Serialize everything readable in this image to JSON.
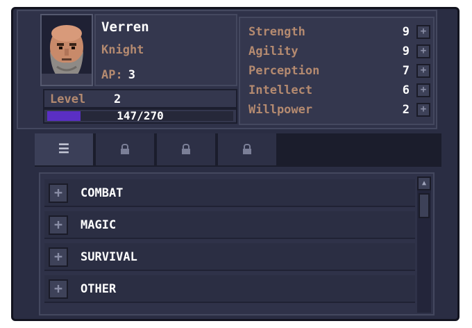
{
  "character": {
    "name": "Verren",
    "class": "Knight",
    "ap_label": "AP:",
    "ap_value": "3",
    "level_label": "Level",
    "level_value": "2",
    "xp_text": "147/270",
    "xp_fraction": 0.18,
    "portrait_icon": "bearded-knight-portrait"
  },
  "stats": [
    {
      "name": "Strength",
      "value": "9",
      "button": "+"
    },
    {
      "name": "Agility",
      "value": "9",
      "button": "+"
    },
    {
      "name": "Perception",
      "value": "7",
      "button": "+"
    },
    {
      "name": "Intellect",
      "value": "6",
      "button": "+"
    },
    {
      "name": "Willpower",
      "value": "2",
      "button": "+"
    }
  ],
  "tabs": [
    {
      "icon": "list-icon",
      "glyph": "☰",
      "active": true
    },
    {
      "icon": "lock-icon",
      "glyph": "🔒",
      "active": false
    },
    {
      "icon": "lock-icon",
      "glyph": "🔒",
      "active": false
    },
    {
      "icon": "lock-icon",
      "glyph": "🔒",
      "active": false
    }
  ],
  "skill_categories": [
    {
      "label": "COMBAT",
      "button": "+"
    },
    {
      "label": "MAGIC",
      "button": "+"
    },
    {
      "label": "SURVIVAL",
      "button": "+"
    },
    {
      "label": "OTHER",
      "button": "+"
    }
  ],
  "colors": {
    "accent_text": "#b48a70",
    "xp_bar": "#5a2fc4",
    "panel": "#2f3249"
  }
}
